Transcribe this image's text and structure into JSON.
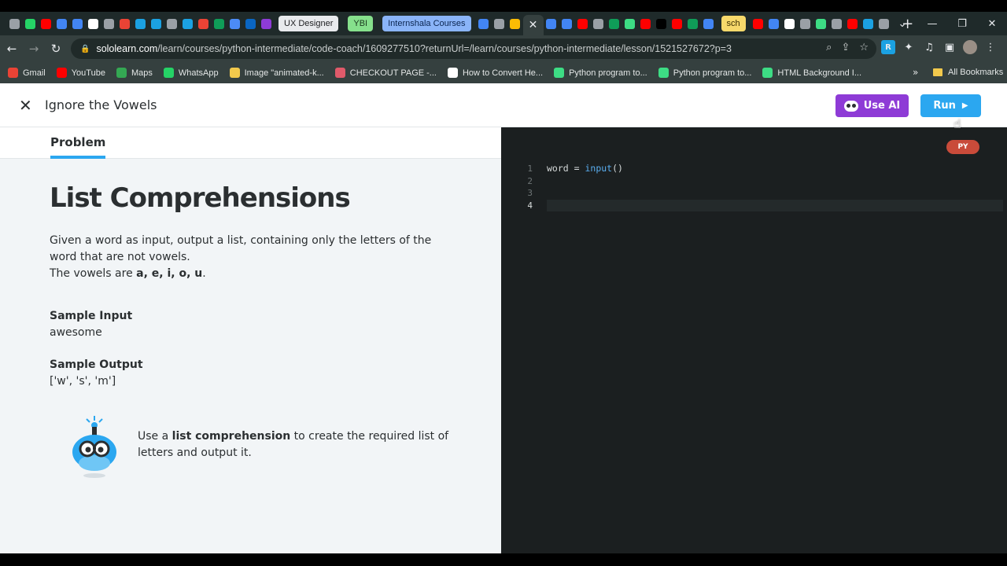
{
  "browser": {
    "tabs": [
      {
        "label": "UX Designer",
        "bg": "#e8eaed",
        "fg": "#202124"
      },
      {
        "label": "YBI",
        "bg": "#86e08c",
        "fg": "#1b3a1e"
      },
      {
        "label": "Internshala Courses",
        "bg": "#8ab4f8",
        "fg": "#0b2550"
      },
      {
        "label": "sch",
        "bg": "#f7d96b",
        "fg": "#3a2e00"
      }
    ],
    "favicon_colors_1": [
      "#9aa0a6",
      "#25d366",
      "#ff0000",
      "#4285f4",
      "#4285f4",
      "#ffffff",
      "#9aa0a6",
      "#ea4335",
      "#1ba1e2",
      "#1ba1e2",
      "#9aa0a6",
      "#1ba1e2",
      "#ea4335",
      "#0f9d58",
      "#4c8bf5",
      "#0a66c2",
      "#8e3bd6"
    ],
    "favicon_colors_2": [
      "#4285f4",
      "#4285f4",
      "#ff0000",
      "#9aa0a6",
      "#0f9d58",
      "#3ddc84",
      "#ff0000",
      "#000000",
      "#ff0000",
      "#0f9d58",
      "#4285f4"
    ],
    "favicon_colors_3": [
      "#ff0000",
      "#4285f4",
      "#ffffff",
      "#9aa0a6",
      "#3ddc84",
      "#9aa0a6",
      "#ff0000",
      "#1ba1e2",
      "#9aa0a6"
    ],
    "new_tab": "+",
    "url_host": "sololearn.com",
    "url_path": "/learn/courses/python-intermediate/code-coach/1609277510?returnUrl=/learn/courses/python-intermediate/lesson/1521527672?p=3",
    "bookmarks": [
      {
        "label": "Gmail",
        "color": "#ea4335"
      },
      {
        "label": "YouTube",
        "color": "#ff0000"
      },
      {
        "label": "Maps",
        "color": "#34a853"
      },
      {
        "label": "WhatsApp",
        "color": "#25d366"
      },
      {
        "label": "Image \"animated-k...",
        "color": "#f2c94c"
      },
      {
        "label": "CHECKOUT PAGE -...",
        "color": "#e05a6a"
      },
      {
        "label": "How to Convert He...",
        "color": "#ffffff"
      },
      {
        "label": "Python program to...",
        "color": "#3ddc84"
      },
      {
        "label": "Python program to...",
        "color": "#3ddc84"
      },
      {
        "label": "HTML Background I...",
        "color": "#3ddc84"
      }
    ],
    "bookmarks_more": "»",
    "all_bookmarks": "All Bookmarks"
  },
  "header": {
    "title": "Ignore the Vowels",
    "use_ai_label": "Use AI",
    "run_label": "Run"
  },
  "problem": {
    "tab_label": "Problem",
    "title": "List Comprehensions",
    "desc_line1": "Given a word as input, output a list, containing only the letters of the word that are not vowels.",
    "vowels_prefix": "The vowels are ",
    "vowels_list": "a, e, i, o, u",
    "vowels_suffix": ".",
    "sample_input_label": "Sample Input",
    "sample_input": "awesome",
    "sample_output_label": "Sample Output",
    "sample_output": "['w', 's', 'm']",
    "hint_prefix": "Use a ",
    "hint_bold": "list comprehension",
    "hint_suffix": " to create the required list of letters and output it."
  },
  "editor": {
    "language_badge": "PY",
    "line_numbers": [
      "1",
      "2",
      "3",
      "4"
    ],
    "code_var": "word = ",
    "code_fn": "input",
    "code_paren": "()"
  }
}
